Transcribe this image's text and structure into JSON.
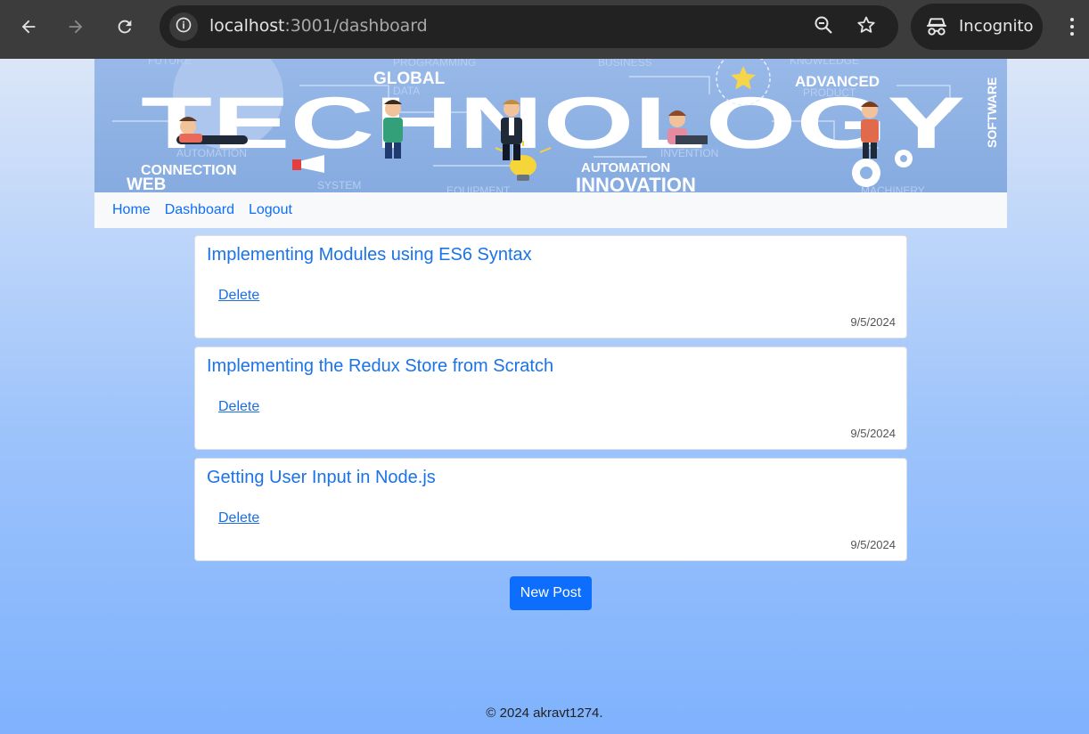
{
  "browser": {
    "url_host": "localhost",
    "url_path": ":3001/dashboard",
    "profile_label": "Incognito"
  },
  "banner": {
    "title": "TECHNOLOGY",
    "words": [
      "GLOBAL",
      "ADVANCED",
      "CONNECTION",
      "WEB",
      "AUTOMATION",
      "INNOVATION",
      "SOFTWARE"
    ],
    "faint_words": [
      "PROGRAMMING",
      "KNOWLEDGE",
      "DATA",
      "PRODUCT",
      "INVENTION",
      "SYSTEM",
      "EQUIPMENT",
      "MACHINERY",
      "AUTOMATION",
      "BUSINESS",
      "FUTURE"
    ]
  },
  "nav": {
    "items": [
      "Home",
      "Dashboard",
      "Logout"
    ]
  },
  "posts": [
    {
      "title": "Implementing Modules using ES6 Syntax",
      "action": "Delete",
      "date": "9/5/2024"
    },
    {
      "title": "Implementing the Redux Store from Scratch",
      "action": "Delete",
      "date": "9/5/2024"
    },
    {
      "title": "Getting User Input in Node.js",
      "action": "Delete",
      "date": "9/5/2024"
    }
  ],
  "new_post_label": "New Post",
  "footer_text": "© 2024 akravt1274.",
  "colors": {
    "accent": "#0d6efd",
    "link": "#1a73e8",
    "chrome_bg": "#3c3c3c"
  },
  "icons": [
    "back-arrow-icon",
    "forward-arrow-icon",
    "reload-icon",
    "site-info-icon",
    "zoom-icon",
    "bookmark-star-icon",
    "incognito-icon",
    "menu-kebab-icon"
  ]
}
